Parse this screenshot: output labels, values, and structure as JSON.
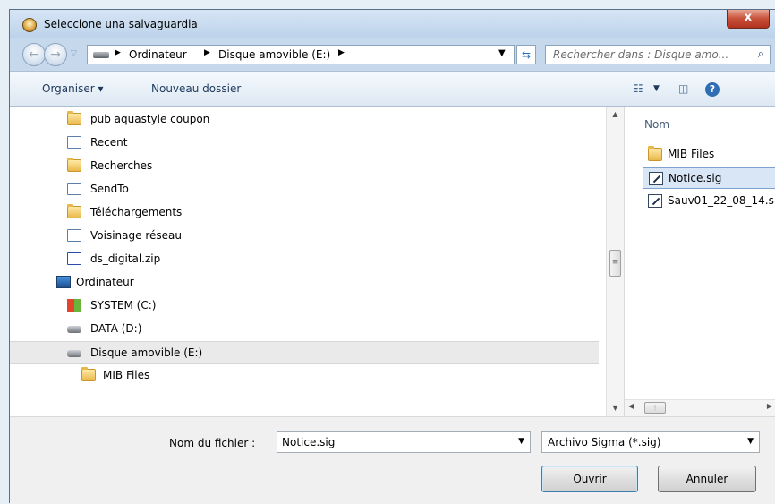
{
  "window": {
    "title": "Seleccione una salvaguardia",
    "close_label": "x"
  },
  "address": {
    "crumbs": [
      "Ordinateur",
      "Disque amovible (E:)"
    ],
    "search_placeholder": "Rechercher dans : Disque amo..."
  },
  "toolbar": {
    "organize_label": "Organiser ▾",
    "new_folder_label": "Nouveau dossier"
  },
  "tree": {
    "items": [
      {
        "label": "pub aquastyle coupon",
        "icon": "folder-icon"
      },
      {
        "label": "Recent",
        "icon": "shortcut-folder-icon"
      },
      {
        "label": "Recherches",
        "icon": "search-folder-icon"
      },
      {
        "label": "SendTo",
        "icon": "shortcut-icon"
      },
      {
        "label": "Téléchargements",
        "icon": "downloads-folder-icon"
      },
      {
        "label": "Voisinage réseau",
        "icon": "shortcut-icon"
      },
      {
        "label": "ds_digital.zip",
        "icon": "zip-file-icon"
      },
      {
        "label": "Ordinateur",
        "icon": "computer-icon"
      },
      {
        "label": "SYSTEM (C:)",
        "icon": "windows-drive-icon"
      },
      {
        "label": "DATA (D:)",
        "icon": "drive-icon"
      },
      {
        "label": "Disque amovible (E:)",
        "icon": "removable-drive-icon",
        "selected": true
      },
      {
        "label": "MIB Files",
        "icon": "folder-icon"
      }
    ]
  },
  "files": {
    "column_header": "Nom",
    "items": [
      {
        "label": "MIB Files",
        "icon": "folder-icon"
      },
      {
        "label": "Notice.sig",
        "icon": "sig-file-icon",
        "selected": true
      },
      {
        "label": "Sauv01_22_08_14.s",
        "icon": "sig-file-icon"
      }
    ]
  },
  "footer": {
    "filename_label": "Nom du fichier :",
    "filename_value": "Notice.sig",
    "filetype_value": "Archivo Sigma (*.sig)",
    "open_label": "Ouvrir",
    "cancel_label": "Annuler"
  }
}
